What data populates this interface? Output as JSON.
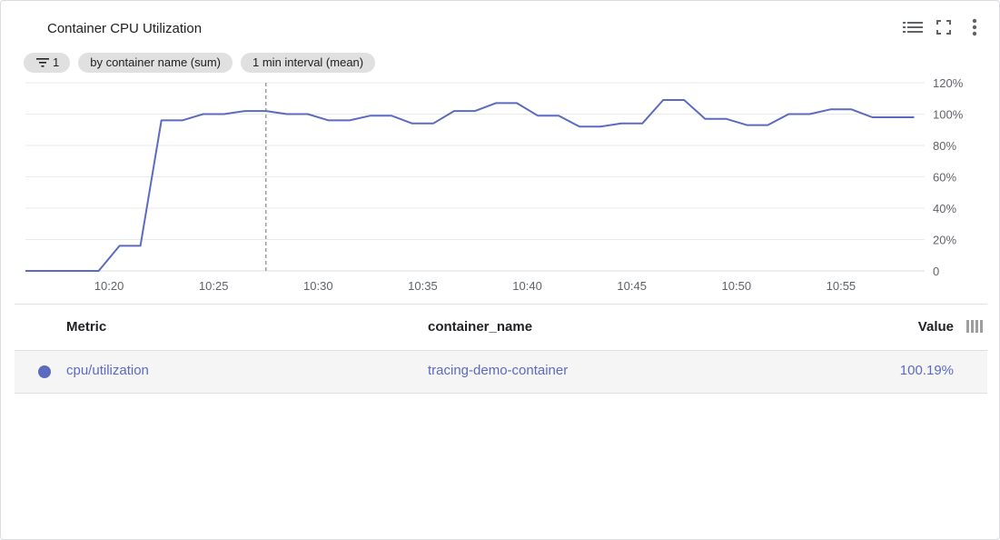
{
  "header": {
    "title": "Container CPU Utilization",
    "legend_icon": "legend-list-icon",
    "fullscreen_icon": "fullscreen-icon",
    "more_icon": "more-vert-icon"
  },
  "chips": {
    "filter_count": "1",
    "group_by": "by container name (sum)",
    "interval": "1 min interval (mean)"
  },
  "colors": {
    "series": "#5c6bc0",
    "grid": "#e8eaed",
    "axis_text": "#5f6368"
  },
  "chart_data": {
    "type": "line",
    "xlabel": "",
    "ylabel": "",
    "ylim": [
      0,
      120
    ],
    "xlim": [
      "10:16",
      "10:59"
    ],
    "y_ticks": [
      "0",
      "20%",
      "40%",
      "60%",
      "80%",
      "100%",
      "120%"
    ],
    "x_ticks": [
      "10:20",
      "10:25",
      "10:30",
      "10:35",
      "10:40",
      "10:45",
      "10:50",
      "10:55"
    ],
    "y_axis_position": "right",
    "grid": true,
    "cursor_x": "10:27.5",
    "series": [
      {
        "name": "cpu/utilization",
        "x": [
          "10:16",
          "10:19.5",
          "10:20.5",
          "10:21.5",
          "10:22.5",
          "10:23.5",
          "10:24.5",
          "10:25.5",
          "10:26.5",
          "10:27.5",
          "10:28.5",
          "10:29.5",
          "10:30.5",
          "10:31.5",
          "10:32.5",
          "10:33.5",
          "10:34.5",
          "10:35.5",
          "10:36.5",
          "10:37.5",
          "10:38.5",
          "10:39.5",
          "10:40.5",
          "10:41.5",
          "10:42.5",
          "10:43.5",
          "10:44.5",
          "10:45.5",
          "10:46.5",
          "10:47.5",
          "10:48.5",
          "10:49.5",
          "10:50.5",
          "10:51.5",
          "10:52.5",
          "10:53.5",
          "10:54.5",
          "10:55.5",
          "10:56.5",
          "10:57.5",
          "10:58.5"
        ],
        "values": [
          0,
          0,
          16,
          16,
          96,
          96,
          100,
          100,
          102,
          102,
          100,
          100,
          96,
          96,
          99,
          99,
          94,
          94,
          102,
          102,
          107,
          107,
          99,
          99,
          92,
          92,
          94,
          94,
          109,
          109,
          97,
          97,
          93,
          93,
          100,
          100,
          103,
          103,
          98,
          98,
          98
        ]
      }
    ]
  },
  "table": {
    "columns": {
      "metric": "Metric",
      "container": "container_name",
      "value": "Value"
    },
    "column_icon": "column-picker-icon",
    "rows": [
      {
        "metric": "cpu/utilization",
        "container": "tracing-demo-container",
        "value": "100.19%"
      }
    ]
  }
}
